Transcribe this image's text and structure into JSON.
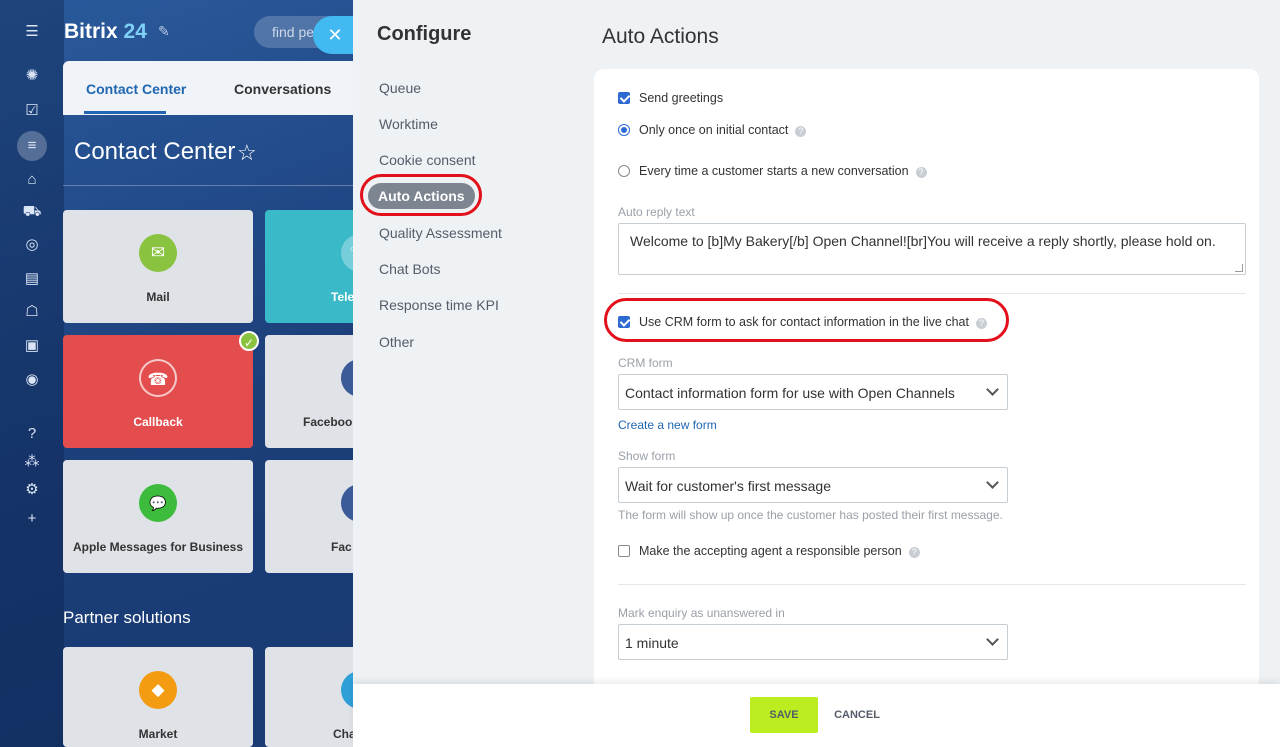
{
  "app": {
    "logo_name": "Bitrix",
    "logo_num": "24",
    "search_placeholder": "find pe",
    "tabs": [
      "Contact Center",
      "Conversations"
    ],
    "page_title": "Contact Center",
    "tiles": [
      {
        "label": "Mail",
        "icon": "✉",
        "color": "#8ac33f"
      },
      {
        "label": "Tele",
        "icon": "☏",
        "color": "#ffffff"
      },
      {
        "label": "Callback",
        "icon": "☎",
        "color": "#e34d4d"
      },
      {
        "label": "Faceboo",
        "icon": "f",
        "color": "#3a5a98"
      },
      {
        "label": "Apple Messages for Business",
        "icon": "💬",
        "color": "#3dbb3d"
      },
      {
        "label": "Fac",
        "icon": "f",
        "color": "#3a5a98"
      },
      {
        "label": "Market",
        "icon": "◆",
        "color": "#f39c12"
      },
      {
        "label": "Cha",
        "icon": "●",
        "color": "#2f9fd8"
      }
    ],
    "partner_title": "Partner solutions"
  },
  "configure": {
    "title": "Configure",
    "menu": [
      "Queue",
      "Worktime",
      "Cookie consent",
      "Auto Actions",
      "Quality Assessment",
      "Chat Bots",
      "Response time KPI",
      "Other"
    ],
    "active_menu": "Auto Actions"
  },
  "panel": {
    "title": "Auto Actions",
    "send_greetings": "Send greetings",
    "only_once": "Only once on initial contact",
    "every_time": "Every time a customer starts a new conversation",
    "auto_reply_label": "Auto reply text",
    "auto_reply_text": "Welcome to [b]My Bakery[/b] Open Channel![br]You will receive a reply shortly, please hold on.",
    "use_crm": "Use CRM form to ask for contact information in the live chat",
    "crm_form_label": "CRM form",
    "crm_form_value": "Contact information form for use with Open Channels",
    "create_form_link": "Create a new form",
    "show_form_label": "Show form",
    "show_form_value": "Wait for customer's first message",
    "show_form_hint": "The form will show up once the customer has posted their first message.",
    "responsible": "Make the accepting agent a responsible person",
    "unanswered_label": "Mark enquiry as unanswered in",
    "unanswered_value": "1 minute",
    "help_glyph": "?"
  },
  "footer": {
    "save": "SAVE",
    "cancel": "CANCEL"
  },
  "colors": {
    "accent": "#2d6bd2",
    "highlight_ring": "#e2101a",
    "save_button": "#bbed21"
  }
}
